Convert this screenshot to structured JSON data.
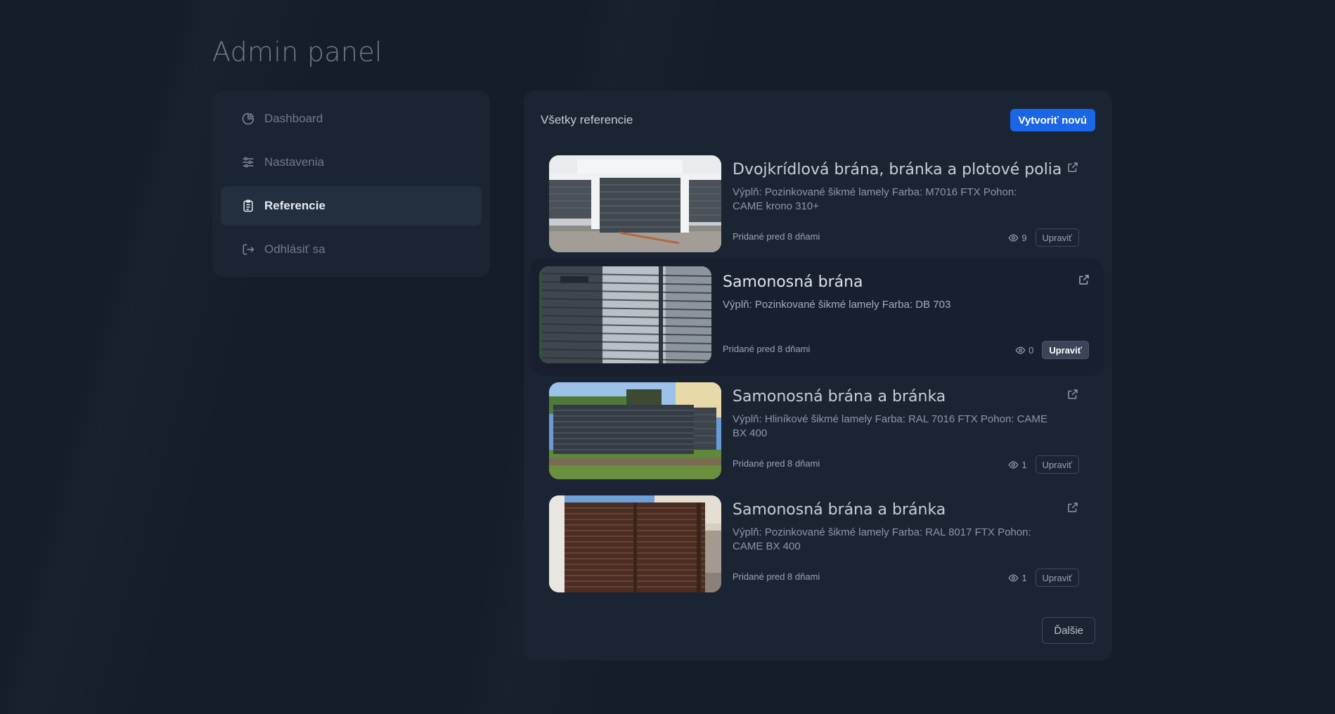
{
  "page": {
    "title": "Admin panel"
  },
  "sidebar": {
    "items": [
      {
        "label": "Dashboard",
        "icon": "pie-chart-icon",
        "active": false
      },
      {
        "label": "Nastavenia",
        "icon": "sliders-icon",
        "active": false
      },
      {
        "label": "Referencie",
        "icon": "clipboard-icon",
        "active": true
      },
      {
        "label": "Odhlásiť sa",
        "icon": "logout-icon",
        "active": false
      }
    ]
  },
  "main": {
    "title": "Všetky referencie",
    "create_button": "Vytvoriť novú",
    "next_button": "Ďalšie",
    "cards": [
      {
        "title": "Dvojkrídlová brána, bránka a plotové polia",
        "description": "Výplň: Pozinkované šikmé lamely Farba: M7016 FTX Pohon: CAME krono 310+",
        "date": "Pridané pred 8 dňami",
        "views": "9",
        "edit_label": "Upraviť"
      },
      {
        "title": "Samonosná brána",
        "description": "Výplň: Pozinkované šikmé lamely Farba: DB 703",
        "date": "Pridané pred 8 dňami",
        "views": "0",
        "edit_label": "Upraviť"
      },
      {
        "title": "Samonosná brána a bránka",
        "description": "Výplň: Hliníkové šikmé lamely Farba: RAL 7016 FTX Pohon: CAME BX 400",
        "date": "Pridané pred 8 dňami",
        "views": "1",
        "edit_label": "Upraviť"
      },
      {
        "title": "Samonosná brána a bránka",
        "description": "Výplň: Pozinkované šikmé lamely Farba: RAL 8017 FTX Pohon: CAME BX 400",
        "date": "Pridané pred 8 dňami",
        "views": "1",
        "edit_label": "Upraviť"
      }
    ]
  },
  "colors": {
    "background": "#151d2b",
    "panel": "#1b2433",
    "accent": "#1b66e6",
    "active_item": "#232e3f"
  }
}
